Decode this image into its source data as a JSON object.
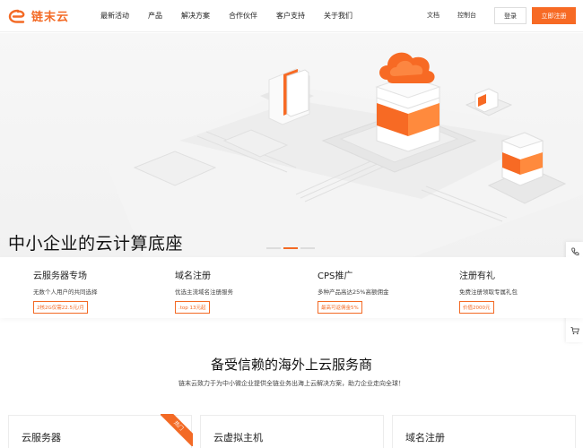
{
  "header": {
    "logo_text": "链末云",
    "nav": [
      "最新活动",
      "产品",
      "解决方案",
      "合作伙伴",
      "客户支持",
      "关于我们"
    ],
    "docs_label": "文档",
    "console_label": "控制台",
    "login_label": "登录",
    "register_label": "立即注册"
  },
  "hero": {
    "title": "中小企业的云计算底座",
    "slides": 3,
    "active_slide": 2
  },
  "features": [
    {
      "title": "云服务器专场",
      "desc": "无数个人用户的共同选择",
      "tag": "2核2G仅需22.5元/月"
    },
    {
      "title": "域名注册",
      "desc": "优选主流域名注册服务",
      "tag": ".top 13元起"
    },
    {
      "title": "CPS推广",
      "desc": "多种产品高达25%高额佣金",
      "tag": "最高可返佣金5%"
    },
    {
      "title": "注册有礼",
      "desc": "免费注册领取专属礼包",
      "tag": "价值2000元"
    }
  ],
  "section": {
    "title": "备受信赖的海外上云服务商",
    "subtitle": "链末云致力于为中小微企业提供全链业务出海上云解决方案，助力企业走向全球！"
  },
  "cards": [
    {
      "title": "云服务器",
      "badge": "热门"
    },
    {
      "title": "云虚拟主机"
    },
    {
      "title": "域名注册"
    }
  ],
  "side_icons": [
    "phone-icon",
    "headset-icon",
    "document-icon",
    "chat-icon",
    "cart-icon"
  ],
  "colors": {
    "accent": "#f36a25"
  }
}
